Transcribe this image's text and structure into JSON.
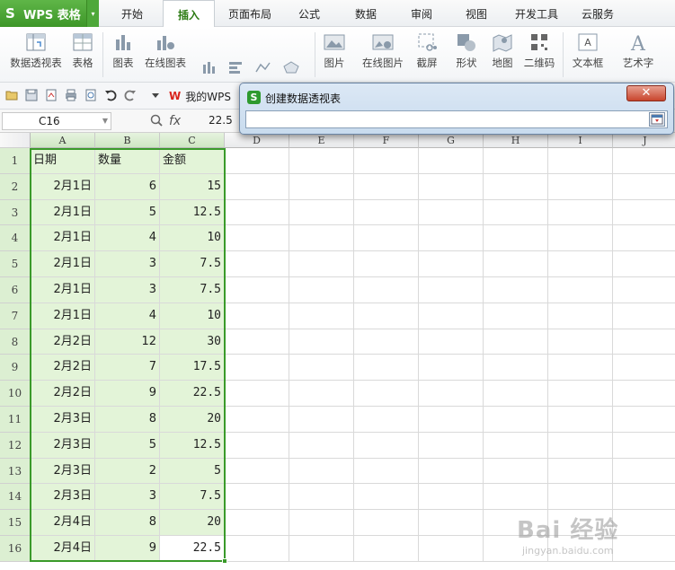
{
  "app": {
    "logo": "S",
    "name": "WPS 表格",
    "dropdown": "▾"
  },
  "menu_tabs": [
    {
      "label": "开始",
      "active": false
    },
    {
      "label": "插入",
      "active": true
    },
    {
      "label": "页面布局",
      "active": false
    },
    {
      "label": "公式",
      "active": false
    },
    {
      "label": "数据",
      "active": false
    },
    {
      "label": "审阅",
      "active": false
    },
    {
      "label": "视图",
      "active": false
    },
    {
      "label": "开发工具",
      "active": false
    },
    {
      "label": "云服务",
      "active": false
    }
  ],
  "ribbon": {
    "pivot": "数据透视表",
    "table": "表格",
    "chart": "图表",
    "online_chart": "在线图表",
    "picture": "图片",
    "online_picture": "在线图片",
    "screenshot": "截屏",
    "shape": "形状",
    "map": "地图",
    "qrcode": "二维码",
    "textbox": "文本框",
    "art": "艺术字"
  },
  "toolbar": {
    "wps_link": "我的WPS",
    "wps_logo": "W"
  },
  "formula_bar": {
    "name_box": "C16",
    "fx": "fx",
    "value": "22.5"
  },
  "dialog": {
    "title": "创建数据透视表",
    "icon": "S",
    "close": "✕",
    "input_value": ""
  },
  "columns": [
    "A",
    "B",
    "C",
    "D",
    "E",
    "F",
    "G",
    "H",
    "I",
    "J"
  ],
  "rows": [
    {
      "n": "1",
      "a": "日期",
      "b": "数量",
      "c": "金额"
    },
    {
      "n": "2",
      "a": "2月1日",
      "b": "6",
      "c": "15"
    },
    {
      "n": "3",
      "a": "2月1日",
      "b": "5",
      "c": "12.5"
    },
    {
      "n": "4",
      "a": "2月1日",
      "b": "4",
      "c": "10"
    },
    {
      "n": "5",
      "a": "2月1日",
      "b": "3",
      "c": "7.5"
    },
    {
      "n": "6",
      "a": "2月1日",
      "b": "3",
      "c": "7.5"
    },
    {
      "n": "7",
      "a": "2月1日",
      "b": "4",
      "c": "10"
    },
    {
      "n": "8",
      "a": "2月2日",
      "b": "12",
      "c": "30"
    },
    {
      "n": "9",
      "a": "2月2日",
      "b": "7",
      "c": "17.5"
    },
    {
      "n": "10",
      "a": "2月2日",
      "b": "9",
      "c": "22.5"
    },
    {
      "n": "11",
      "a": "2月3日",
      "b": "8",
      "c": "20"
    },
    {
      "n": "12",
      "a": "2月3日",
      "b": "5",
      "c": "12.5"
    },
    {
      "n": "13",
      "a": "2月3日",
      "b": "2",
      "c": "5"
    },
    {
      "n": "14",
      "a": "2月3日",
      "b": "3",
      "c": "7.5"
    },
    {
      "n": "15",
      "a": "2月4日",
      "b": "8",
      "c": "20"
    },
    {
      "n": "16",
      "a": "2月4日",
      "b": "9",
      "c": "22.5"
    }
  ],
  "watermark": {
    "text": "Bai 经验",
    "sub": "jingyan.baidu.com"
  },
  "colors": {
    "accent": "#3a9a2a",
    "selection_fill": "#e3f4d8",
    "dialog_close": "#c8452d"
  }
}
